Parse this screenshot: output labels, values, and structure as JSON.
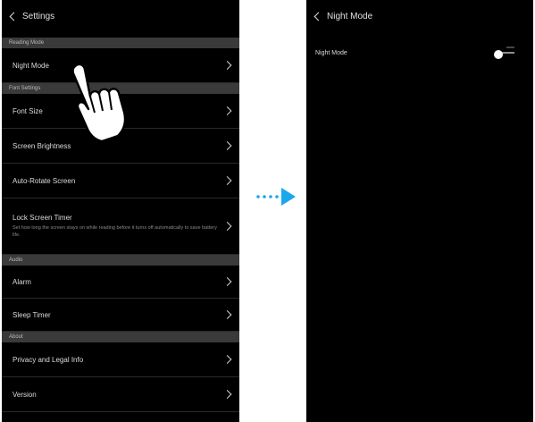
{
  "left": {
    "title": "Settings",
    "sections": [
      {
        "header": "Reading Mode",
        "items": [
          {
            "label": "Night Mode",
            "desc": ""
          }
        ]
      },
      {
        "header": "Font Settings",
        "items": [
          {
            "label": "Font Size",
            "desc": ""
          },
          {
            "label": "Screen Brightness",
            "desc": ""
          },
          {
            "label": "Auto-Rotate Screen",
            "desc": ""
          },
          {
            "label": "Lock Screen Timer",
            "desc": "Set how long the screen stays on while reading before it turns off automatically to save battery life."
          }
        ]
      },
      {
        "header": "Audio",
        "items": [
          {
            "label": "Alarm",
            "desc": ""
          },
          {
            "label": "Sleep Timer",
            "desc": ""
          }
        ]
      },
      {
        "header": "About",
        "items": [
          {
            "label": "Privacy and Legal Info",
            "desc": ""
          },
          {
            "label": "Version",
            "desc": ""
          }
        ]
      }
    ]
  },
  "right": {
    "title": "Night Mode",
    "row_label": "Night Mode",
    "toggle_on": false
  },
  "colors": {
    "screen_bg": "#000000",
    "section_bg": "#3a3a3a",
    "arrow": "#1aa7ec"
  }
}
